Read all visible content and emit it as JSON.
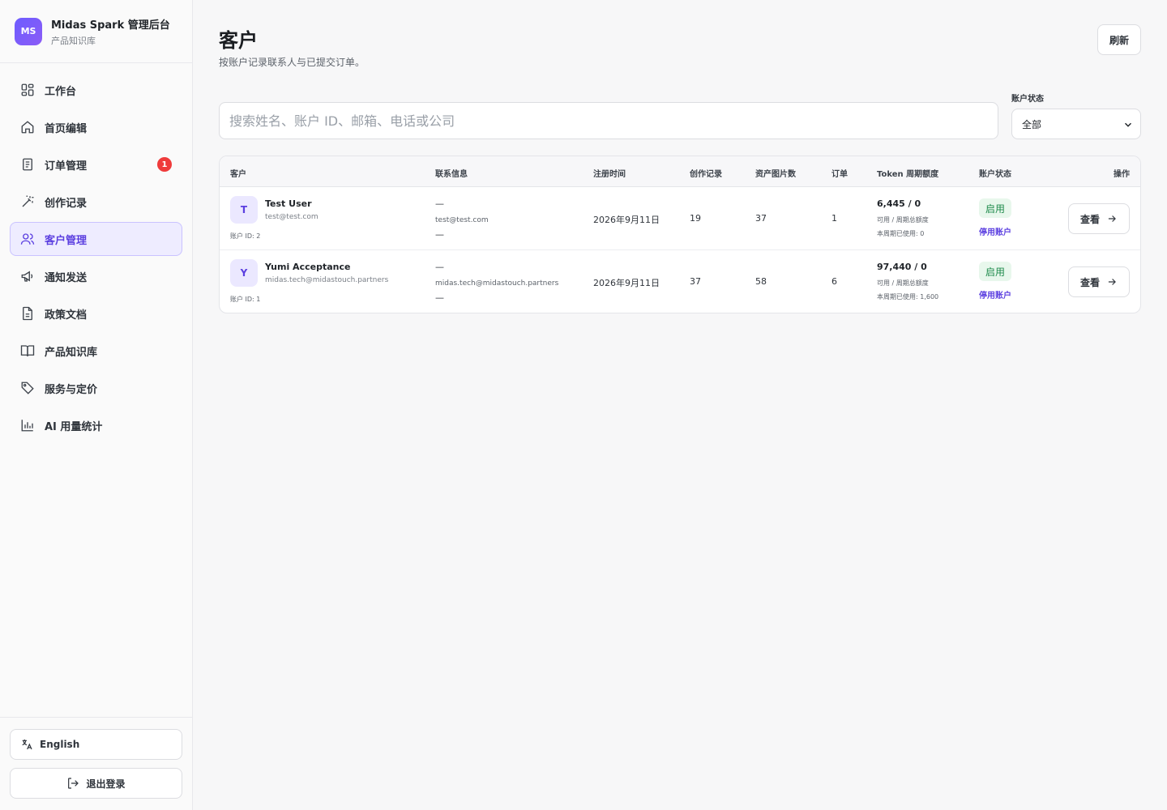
{
  "brand": {
    "logo": "MS",
    "title": "Midas Spark 管理后台",
    "subtitle": "产品知识库"
  },
  "nav": [
    {
      "label": "工作台",
      "icon": "dashboard-icon"
    },
    {
      "label": "首页编辑",
      "icon": "home-icon"
    },
    {
      "label": "订单管理",
      "icon": "receipt-icon",
      "badge": "1"
    },
    {
      "label": "创作记录",
      "icon": "magic-wand-icon"
    },
    {
      "label": "客户管理",
      "icon": "users-icon",
      "active": true
    },
    {
      "label": "通知发送",
      "icon": "megaphone-icon"
    },
    {
      "label": "政策文档",
      "icon": "document-icon"
    },
    {
      "label": "产品知识库",
      "icon": "book-icon"
    },
    {
      "label": "服务与定价",
      "icon": "tag-icon"
    },
    {
      "label": "AI 用量统计",
      "icon": "bar-chart-icon"
    }
  ],
  "sidebar_bottom": {
    "language": "English",
    "logout": "退出登录"
  },
  "header": {
    "title": "客户",
    "subtitle": "按账户记录联系人与已提交订单。",
    "refresh": "刷新"
  },
  "filters": {
    "search_placeholder": "搜索姓名、账户 ID、邮箱、电话或公司",
    "status_label": "账户状态",
    "status_value": "全部"
  },
  "table": {
    "columns": [
      "客户",
      "联系信息",
      "注册时间",
      "创作记录",
      "资产图片数",
      "订单",
      "Token 周期额度",
      "账户状态",
      "操作"
    ],
    "rows": [
      {
        "initial": "T",
        "name": "Test User",
        "email": "test@test.com",
        "account_id": "账户 ID: 2",
        "contact_line1": "—",
        "contact_email": "test@test.com",
        "contact_line3": "—",
        "registered": "2026年9月11日",
        "creations": "19",
        "assets": "37",
        "orders": "1",
        "token_main": "6,445 / 0",
        "token_sub": "可用 / 周期总额度",
        "token_used": "本周期已使用: 0",
        "status": "启用",
        "disable": "停用账户",
        "view": "查看"
      },
      {
        "initial": "Y",
        "name": "Yumi Acceptance",
        "email": "midas.tech@midastouch.partners",
        "account_id": "账户 ID: 1",
        "contact_line1": "—",
        "contact_email": "midas.tech@midastouch.partners",
        "contact_line3": "—",
        "registered": "2026年9月11日",
        "creations": "37",
        "assets": "58",
        "orders": "6",
        "token_main": "97,440 / 0",
        "token_sub": "可用 / 周期总额度",
        "token_used": "本周期已使用: 1,600",
        "status": "启用",
        "disable": "停用账户",
        "view": "查看"
      }
    ]
  },
  "colors": {
    "accent": "#5b3fe0",
    "badge": "#ef3b3b",
    "status_green": "#1f8b4c"
  }
}
